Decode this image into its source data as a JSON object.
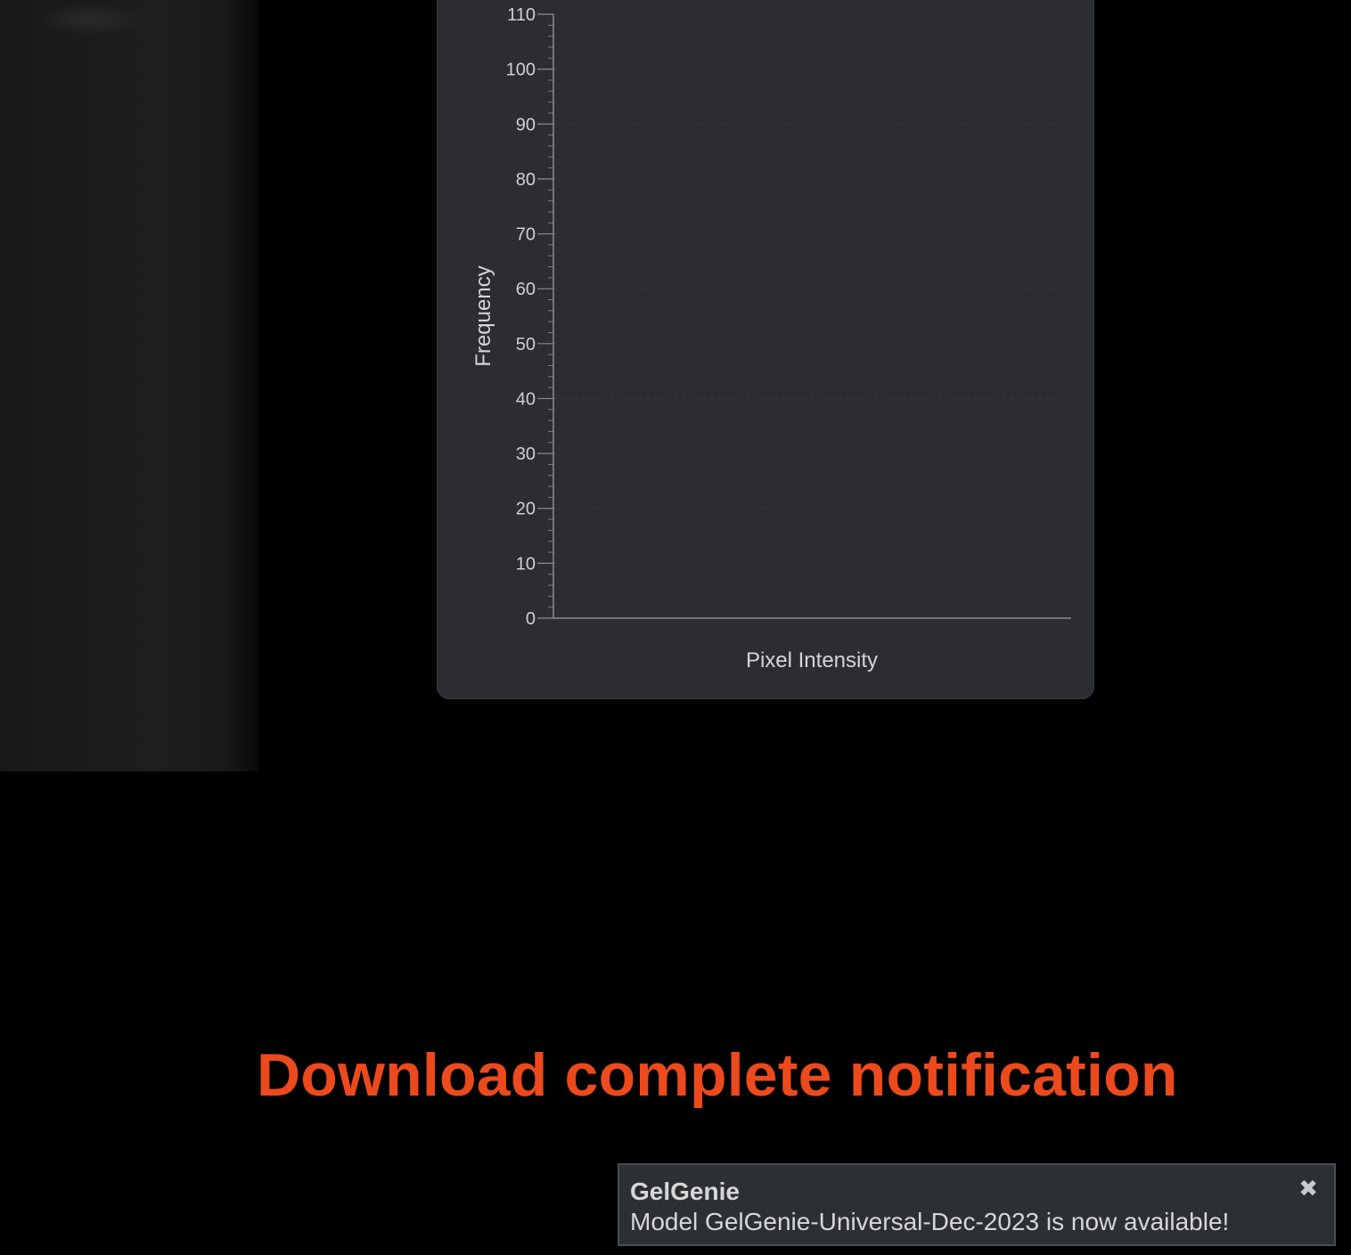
{
  "histogram": {
    "chart_data": {
      "type": "bar",
      "xlabel": "Pixel Intensity",
      "ylabel": "Frequency",
      "ylim": [
        0,
        110
      ],
      "yticks": [
        0,
        10,
        20,
        30,
        40,
        50,
        60,
        70,
        80,
        90,
        100,
        110
      ],
      "series": [],
      "grid": true
    }
  },
  "heading": {
    "text": "Download complete notification"
  },
  "toast": {
    "title": "GelGenie",
    "message": "Model GelGenie-Universal-Dec-2023 is now available!",
    "close_icon": "close-icon",
    "close_glyph": "✖"
  },
  "colors": {
    "heading": "#ec4a1c",
    "panel_bg": "#2b2d30",
    "toast_bg": "#2d3033"
  }
}
